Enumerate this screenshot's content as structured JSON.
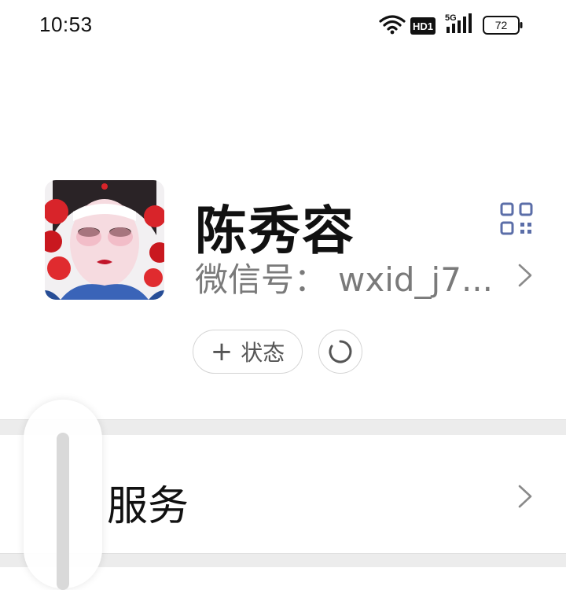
{
  "status_bar": {
    "time": "10:53",
    "network_badge": "HD1",
    "network_type": "5G",
    "battery_level": "72",
    "icons": [
      "wifi-icon",
      "hd-badge-icon",
      "signal-icon",
      "battery-icon"
    ]
  },
  "profile": {
    "avatar_icon": "opera-avatar-image",
    "nickname": "陈秀容",
    "wechat_id_label": "微信号：",
    "wechat_id_value": "wxid_j7...",
    "qr_icon": "qr-code-icon",
    "chevron_icon": "chevron-right-icon"
  },
  "status_actions": {
    "add_status_plus": "+",
    "add_status_label": "状态",
    "refresh_icon": "circle-refresh-icon"
  },
  "sections": [
    {
      "label": "服务",
      "icon": "chevron-right-icon"
    }
  ],
  "colors": {
    "qr_icon": "#5b6ea8",
    "secondary_text": "#7a7a7a",
    "divider": "#ececec"
  }
}
